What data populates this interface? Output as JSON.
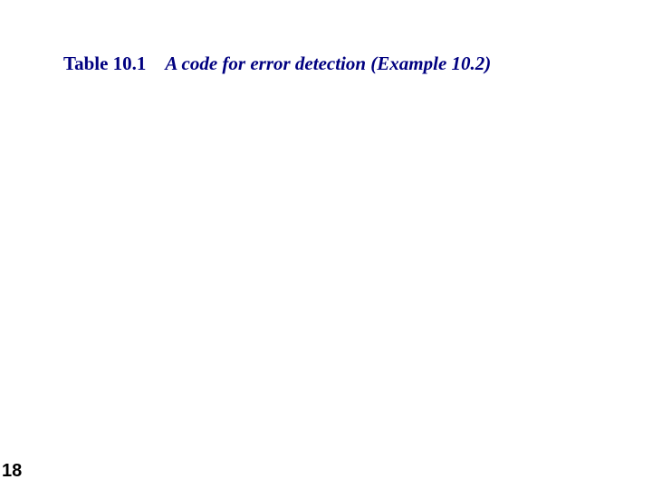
{
  "caption": {
    "label": "Table 10.1",
    "text": "A code for error detection (Example 10.2)"
  },
  "page_number": "18"
}
